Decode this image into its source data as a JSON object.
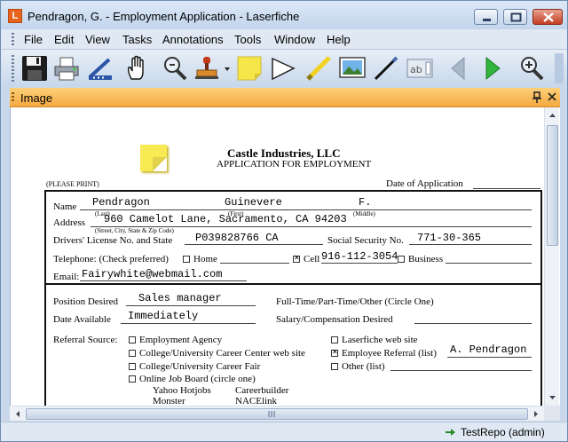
{
  "window": {
    "title": "Pendragon, G. - Employment Application - Laserfiche",
    "app_icon_letter": "L"
  },
  "menu": [
    "File",
    "Edit",
    "View",
    "Tasks",
    "Annotations",
    "Tools",
    "Window",
    "Help"
  ],
  "toolbar": {
    "icons": [
      "save-icon",
      "print-icon",
      "scanner-icon",
      "pan-hand-icon",
      "zoom-icon",
      "stamp-icon",
      "sticky-note-icon",
      "pointer-icon",
      "highlighter-icon",
      "image-icon",
      "pen-icon",
      "text-box-icon",
      "back-arrow-icon",
      "forward-arrow-icon",
      "magnifier-icon"
    ],
    "text_box_glyph": "ab"
  },
  "pane": {
    "title": "Image"
  },
  "document": {
    "company": "Castle Industries, LLC",
    "subtitle": "APPLICATION FOR EMPLOYMENT",
    "please_print": "(PLEASE PRINT)",
    "date_of_application_label": "Date of Application",
    "name_label": "Name",
    "name_last": "Pendragon",
    "name_first": "Guinevere",
    "name_middle": "F.",
    "hint_last": "(Last)",
    "hint_first": "(First)",
    "hint_middle": "(Middle)",
    "address_label": "Address",
    "address_value": "960 Camelot Lane, Sacramento, CA 94203",
    "address_hint": "(Street, City, State & Zip Code)",
    "dl_label": "Drivers' License No. and State",
    "dl_value": "P039828766 CA",
    "ssn_label": "Social Security No.",
    "ssn_value": "771-30-365",
    "telephone_label": "Telephone: (Check preferred)",
    "home_label": "Home",
    "cell_label": "Cell",
    "cell_value": "916-112-3054",
    "business_label": "Business",
    "email_label": "Email:",
    "email_value": "Fairywhite@webmail.com",
    "position_label": "Position Desired",
    "position_value": "Sales manager",
    "fulltime_label": "Full-Time/Part-Time/Other (Circle One)",
    "date_available_label": "Date Available",
    "date_available_value": "Immediately",
    "salary_label": "Salary/Compensation Desired",
    "referral_label": "Referral Source:",
    "ref_employment_agency": "Employment Agency",
    "ref_college_web": "College/University Career Center web site",
    "ref_college_fair": "College/University Career Fair",
    "ref_online_board": "Online Job Board (circle one)",
    "ref_yahoo": "Yahoo Hotjobs",
    "ref_careerbuilder": "Careerbuilder",
    "ref_monster": "Monster",
    "ref_naceLink": "NACElink",
    "ref_laserfiche": "Laserfiche web site",
    "ref_employee": "Employee Referral (list)",
    "ref_employee_value": "A. Pendragon",
    "ref_other": "Other (list)"
  },
  "status": {
    "repository": "TestRepo (admin)"
  }
}
